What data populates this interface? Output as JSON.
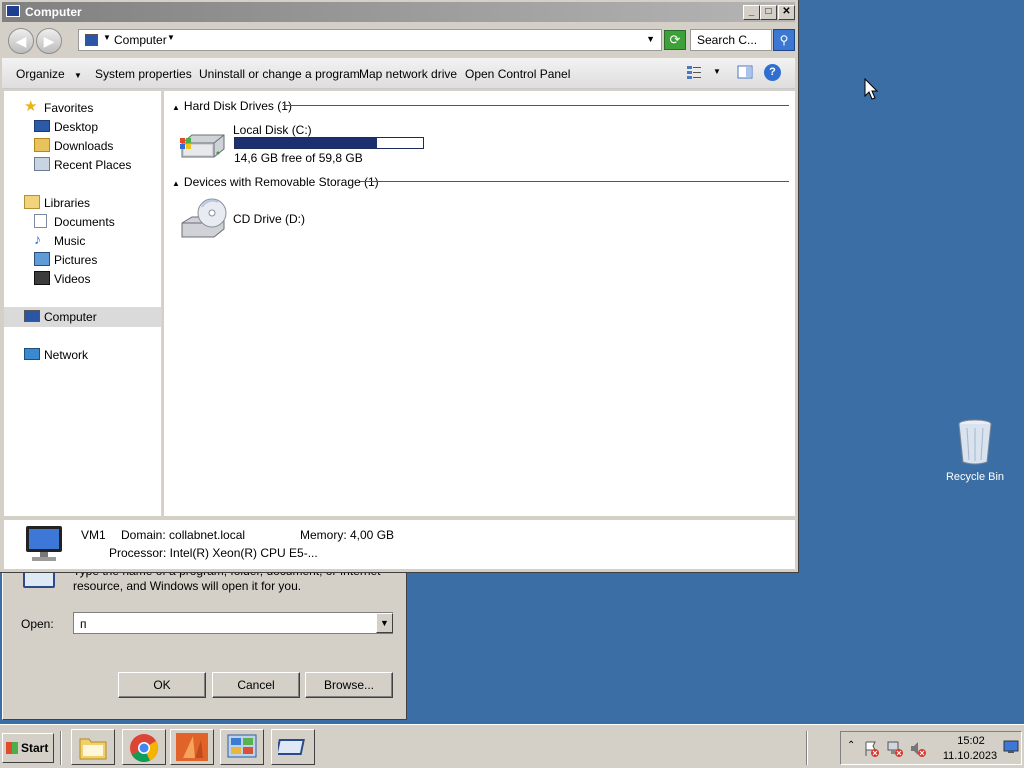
{
  "run_dialog": {
    "description": "Type the name of a program, folder, document, or Internet resource, and Windows will open it for you.",
    "open_label": "Open:",
    "open_value": "п",
    "ok_label": "OK",
    "cancel_label": "Cancel",
    "browse_label": "Browse..."
  },
  "explorer": {
    "title": "Computer",
    "address": {
      "crumb": "Computer"
    },
    "search_placeholder": "Search C...",
    "toolbar": {
      "organize": "Organize",
      "system_properties": "System properties",
      "uninstall": "Uninstall or change a program",
      "map_drive": "Map network drive",
      "control_panel": "Open Control Panel"
    },
    "nav": {
      "favorites": "Favorites",
      "desktop": "Desktop",
      "downloads": "Downloads",
      "recent_places": "Recent Places",
      "libraries": "Libraries",
      "documents": "Documents",
      "music": "Music",
      "pictures": "Pictures",
      "videos": "Videos",
      "computer": "Computer",
      "network": "Network"
    },
    "groups": {
      "hdd_header": "Hard Disk Drives (1)",
      "removable_header": "Devices with Removable Storage (1)"
    },
    "drives": {
      "local_disk_name": "Local Disk (C:)",
      "local_disk_free": "14,6 GB free of 59,8 GB",
      "local_disk_used_fraction": 0.756,
      "cd_drive_name": "CD Drive (D:)"
    },
    "details": {
      "computer_name": "VM1",
      "domain": "Domain: collabnet.local",
      "memory": "Memory: 4,00 GB",
      "processor": "Processor: Intel(R) Xeon(R) CPU E5-..."
    }
  },
  "desktop": {
    "recycle_bin": "Recycle Bin"
  },
  "taskbar": {
    "start": "Start",
    "time": "15:02",
    "date": "11.10.2023"
  },
  "colors": {
    "desktop": "#3a6ea5",
    "progress_fill": "#1c2f6e",
    "window_face": "#d4d0c8"
  }
}
